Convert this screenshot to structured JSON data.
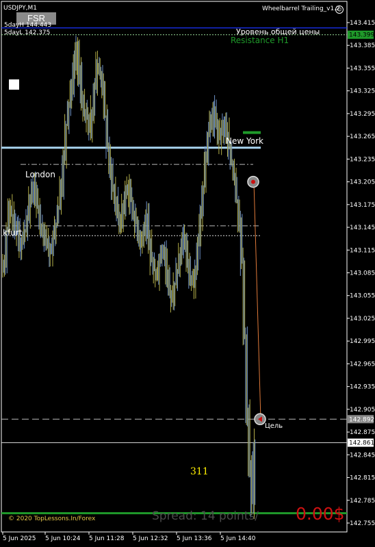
{
  "header": {
    "symbol": "USDJPY,M1",
    "expert": "Wheelbarrel Trailing_v1.2",
    "five_day_high": "5dayH 144.443",
    "five_day_low": "5dayL 142.375"
  },
  "buttons": {
    "fsr": "FSR"
  },
  "annotations": {
    "price_level_ru": "Уровень общей цены",
    "resistance": "Resistance H1",
    "new_york": "New York",
    "london": "London",
    "frankfurt": "kfurt",
    "target_ru": "Цель",
    "counter": "311",
    "copyright": "© 2020 TopLessons.In/Forex",
    "spread": "Spread: 14 points/",
    "profit": "0.00$"
  },
  "colors": {
    "background": "#000000",
    "bull_candle": "#6f93c9",
    "bear_candle": "#b5b04a",
    "resistance": "#1f9a2a",
    "new_york_line": "#a8d4f0",
    "target_line": "#e07a3a",
    "profit": "#cc1111",
    "counter": "#ffee00",
    "highline": "#1a33ff"
  },
  "chart_data": {
    "type": "candlestick",
    "y_ticks": [
      "143.415",
      "143.385",
      "143.355",
      "143.325",
      "143.295",
      "143.265",
      "143.235",
      "143.205",
      "143.175",
      "143.145",
      "143.115",
      "143.085",
      "143.055",
      "143.025",
      "142.995",
      "142.965",
      "142.935",
      "142.905",
      "142.875",
      "142.845",
      "142.815",
      "142.785",
      "142.755"
    ],
    "ylim": [
      142.75,
      143.42
    ],
    "x_ticks": [
      "5 Jun 2025",
      "5 Jun 10:24",
      "5 Jun 11:28",
      "5 Jun 12:32",
      "5 Jun 13:36",
      "5 Jun 14:40"
    ],
    "price_labels": [
      {
        "value": 143.399,
        "text": "143.399",
        "kind": "resistance"
      },
      {
        "value": 142.892,
        "text": "142.892",
        "kind": "target"
      },
      {
        "value": 142.861,
        "text": "142.861",
        "kind": "current"
      }
    ],
    "levels": {
      "five_day_high": 143.408,
      "resistance": 143.399,
      "resistance_h1_segment": 143.27,
      "new_york": 143.25,
      "session_dash_1": 143.228,
      "session_dash_2": 143.147,
      "session_dot": 143.134,
      "target": 142.892,
      "current": 142.861,
      "bottom_green": 142.768
    },
    "close_path": [
      143.09,
      143.1,
      143.14,
      143.17,
      143.16,
      143.14,
      143.15,
      143.12,
      143.13,
      143.14,
      143.16,
      143.18,
      143.2,
      143.19,
      143.17,
      143.15,
      143.14,
      143.13,
      143.12,
      143.11,
      143.13,
      143.15,
      143.17,
      143.2,
      143.24,
      143.28,
      143.31,
      143.33,
      143.36,
      143.38,
      143.35,
      143.31,
      143.3,
      143.29,
      143.27,
      143.3,
      143.33,
      143.36,
      143.35,
      143.33,
      143.29,
      143.25,
      143.22,
      143.2,
      143.18,
      143.16,
      143.15,
      143.17,
      143.19,
      143.2,
      143.18,
      143.16,
      143.15,
      143.13,
      143.12,
      143.14,
      143.16,
      143.13,
      143.1,
      143.09,
      143.08,
      143.1,
      143.12,
      143.11,
      143.08,
      143.06,
      143.05,
      143.07,
      143.09,
      143.11,
      143.13,
      143.12,
      143.1,
      143.08,
      143.07,
      143.09,
      143.12,
      143.16,
      143.2,
      143.24,
      143.27,
      143.28,
      143.3,
      143.28,
      143.26,
      143.27,
      143.28,
      143.27,
      143.25,
      143.23,
      143.21,
      143.18,
      143.15,
      143.1,
      143.0,
      142.9,
      142.83,
      142.78,
      142.86
    ]
  }
}
